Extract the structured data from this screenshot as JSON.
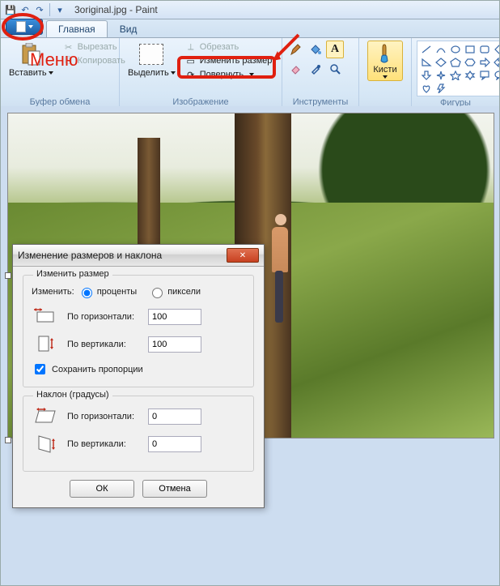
{
  "titlebar": {
    "title": "3original.jpg - Paint"
  },
  "filemenu": {
    "annotation": "Меню"
  },
  "tabs": {
    "home": "Главная",
    "view": "Вид"
  },
  "ribbon": {
    "clipboard": {
      "paste": "Вставить",
      "cut": "Вырезать",
      "copy": "Копировать",
      "label": "Буфер обмена"
    },
    "image": {
      "select": "Выделить",
      "crop": "Обрезать",
      "resize": "Изменить размер",
      "rotate": "Повернуть",
      "label": "Изображение"
    },
    "tools": {
      "label": "Инструменты"
    },
    "brushes": {
      "label": "Кисти"
    },
    "shapes": {
      "label": "Фигуры"
    }
  },
  "dialog": {
    "title": "Изменение размеров и наклона",
    "resize": {
      "legend": "Изменить размер",
      "by_label": "Изменить:",
      "percent": "проценты",
      "pixels": "пиксели",
      "horizontal": "По горизонтали:",
      "vertical": "По вертикали:",
      "hval": "100",
      "vval": "100",
      "keep_ratio": "Сохранить пропорции"
    },
    "skew": {
      "legend": "Наклон (градусы)",
      "horizontal": "По горизонтали:",
      "vertical": "По вертикали:",
      "hval": "0",
      "vval": "0"
    },
    "ok": "ОК",
    "cancel": "Отмена"
  }
}
